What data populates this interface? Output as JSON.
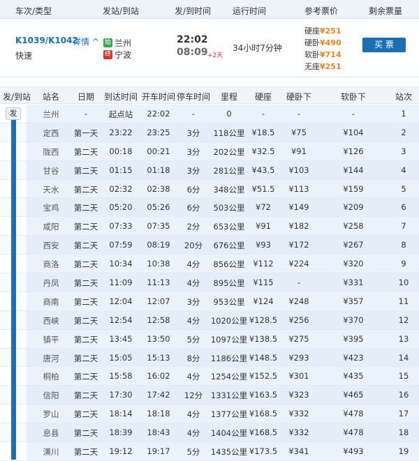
{
  "header": {
    "col_train": "车次/类型",
    "col_station": "发站/到站",
    "col_time": "发/到时间",
    "col_duration": "运行时间",
    "col_price": "参考票价",
    "col_remaining": "剩余票量"
  },
  "train": {
    "number": "K1039/K1042",
    "detail_label": "详情 ^",
    "type": "快速",
    "from_icon": "始",
    "from_station": "兰州",
    "to_icon": "终",
    "to_station": "宁波",
    "depart_time": "22:02",
    "arrive_time": "08:09",
    "plus_days": "+2天",
    "duration": "34小时7分钟",
    "prices": [
      {
        "seat": "硬座",
        "price": "¥251"
      },
      {
        "seat": "硬卧",
        "price": "¥490"
      },
      {
        "seat": "软卧",
        "price": "¥714"
      },
      {
        "seat": "无座",
        "price": "¥251"
      }
    ],
    "buy_label": "买 票"
  },
  "stops_header": {
    "depart_arrive": "发/到站",
    "station": "站名",
    "date": "日期",
    "arrival": "到达时间",
    "departure": "开车时间",
    "stop": "停车时间",
    "mileage": "里程",
    "hard_seat": "硬座",
    "hard_sleeper": "硬卧下",
    "soft_sleeper": "软卧下",
    "order": "站次"
  },
  "depart_marker": "发",
  "stops": [
    {
      "station": "兰州",
      "date": "-",
      "arrive": "起点站",
      "depart": "22:02",
      "stop": "-",
      "mileage": "0",
      "hard_seat": "-",
      "hard_sleeper": "-",
      "soft_sleeper": "-",
      "order": "1"
    },
    {
      "station": "定西",
      "date": "第一天",
      "arrive": "23:22",
      "depart": "23:25",
      "stop": "3分",
      "mileage": "118公里",
      "hard_seat": "¥18.5",
      "hard_sleeper": "¥75",
      "soft_sleeper": "¥104",
      "order": "2"
    },
    {
      "station": "陇西",
      "date": "第二天",
      "arrive": "00:18",
      "depart": "00:21",
      "stop": "3分",
      "mileage": "202公里",
      "hard_seat": "¥32.5",
      "hard_sleeper": "¥91",
      "soft_sleeper": "¥126",
      "order": "3"
    },
    {
      "station": "甘谷",
      "date": "第二天",
      "arrive": "01:15",
      "depart": "01:18",
      "stop": "3分",
      "mileage": "281公里",
      "hard_seat": "¥43.5",
      "hard_sleeper": "¥103",
      "soft_sleeper": "¥144",
      "order": "4"
    },
    {
      "station": "天水",
      "date": "第二天",
      "arrive": "02:32",
      "depart": "02:38",
      "stop": "6分",
      "mileage": "348公里",
      "hard_seat": "¥51.5",
      "hard_sleeper": "¥113",
      "soft_sleeper": "¥159",
      "order": "5"
    },
    {
      "station": "宝鸡",
      "date": "第二天",
      "arrive": "05:20",
      "depart": "05:26",
      "stop": "6分",
      "mileage": "503公里",
      "hard_seat": "¥72",
      "hard_sleeper": "¥149",
      "soft_sleeper": "¥209",
      "order": "6"
    },
    {
      "station": "咸阳",
      "date": "第二天",
      "arrive": "07:33",
      "depart": "07:35",
      "stop": "2分",
      "mileage": "653公里",
      "hard_seat": "¥91",
      "hard_sleeper": "¥182",
      "soft_sleeper": "¥258",
      "order": "7"
    },
    {
      "station": "西安",
      "date": "第二天",
      "arrive": "07:59",
      "depart": "08:19",
      "stop": "20分",
      "mileage": "676公里",
      "hard_seat": "¥93",
      "hard_sleeper": "¥172",
      "soft_sleeper": "¥267",
      "order": "8"
    },
    {
      "station": "商洛",
      "date": "第二天",
      "arrive": "10:34",
      "depart": "10:38",
      "stop": "4分",
      "mileage": "856公里",
      "hard_seat": "¥112",
      "hard_sleeper": "¥224",
      "soft_sleeper": "¥320",
      "order": "9"
    },
    {
      "station": "丹凤",
      "date": "第二天",
      "arrive": "11:09",
      "depart": "11:13",
      "stop": "4分",
      "mileage": "895公里",
      "hard_seat": "¥115",
      "hard_sleeper": "-",
      "soft_sleeper": "¥331",
      "order": "10"
    },
    {
      "station": "商南",
      "date": "第二天",
      "arrive": "12:04",
      "depart": "12:07",
      "stop": "3分",
      "mileage": "953公里",
      "hard_seat": "¥124",
      "hard_sleeper": "¥248",
      "soft_sleeper": "¥357",
      "order": "11"
    },
    {
      "station": "西峡",
      "date": "第二天",
      "arrive": "12:54",
      "depart": "12:58",
      "stop": "4分",
      "mileage": "1020公里",
      "hard_seat": "¥128.5",
      "hard_sleeper": "¥256",
      "soft_sleeper": "¥370",
      "order": "12"
    },
    {
      "station": "镇平",
      "date": "第二天",
      "arrive": "13:45",
      "depart": "13:50",
      "stop": "5分",
      "mileage": "1097公里",
      "hard_seat": "¥138.5",
      "hard_sleeper": "¥275",
      "soft_sleeper": "¥395",
      "order": "13"
    },
    {
      "station": "唐河",
      "date": "第二天",
      "arrive": "15:05",
      "depart": "15:13",
      "stop": "8分",
      "mileage": "1186公里",
      "hard_seat": "¥148.5",
      "hard_sleeper": "¥293",
      "soft_sleeper": "¥423",
      "order": "14"
    },
    {
      "station": "桐柏",
      "date": "第二天",
      "arrive": "15:58",
      "depart": "16:02",
      "stop": "4分",
      "mileage": "1254公里",
      "hard_seat": "¥152.5",
      "hard_sleeper": "¥301",
      "soft_sleeper": "¥435",
      "order": "15"
    },
    {
      "station": "信阳",
      "date": "第二天",
      "arrive": "17:30",
      "depart": "17:42",
      "stop": "12分",
      "mileage": "1331公里",
      "hard_seat": "¥163.5",
      "hard_sleeper": "¥323",
      "soft_sleeper": "¥465",
      "order": "16"
    },
    {
      "station": "罗山",
      "date": "第二天",
      "arrive": "18:14",
      "depart": "18:18",
      "stop": "4分",
      "mileage": "1377公里",
      "hard_seat": "¥168.5",
      "hard_sleeper": "¥332",
      "soft_sleeper": "¥478",
      "order": "17"
    },
    {
      "station": "息县",
      "date": "第二天",
      "arrive": "18:39",
      "depart": "18:43",
      "stop": "4分",
      "mileage": "1404公里",
      "hard_seat": "¥168.5",
      "hard_sleeper": "¥332",
      "soft_sleeper": "¥478",
      "order": "18"
    },
    {
      "station": "潢川",
      "date": "第二天",
      "arrive": "19:12",
      "depart": "19:17",
      "stop": "5分",
      "mileage": "1435公里",
      "hard_seat": "¥173.5",
      "hard_sleeper": "¥341",
      "soft_sleeper": "¥493",
      "order": "19"
    }
  ]
}
